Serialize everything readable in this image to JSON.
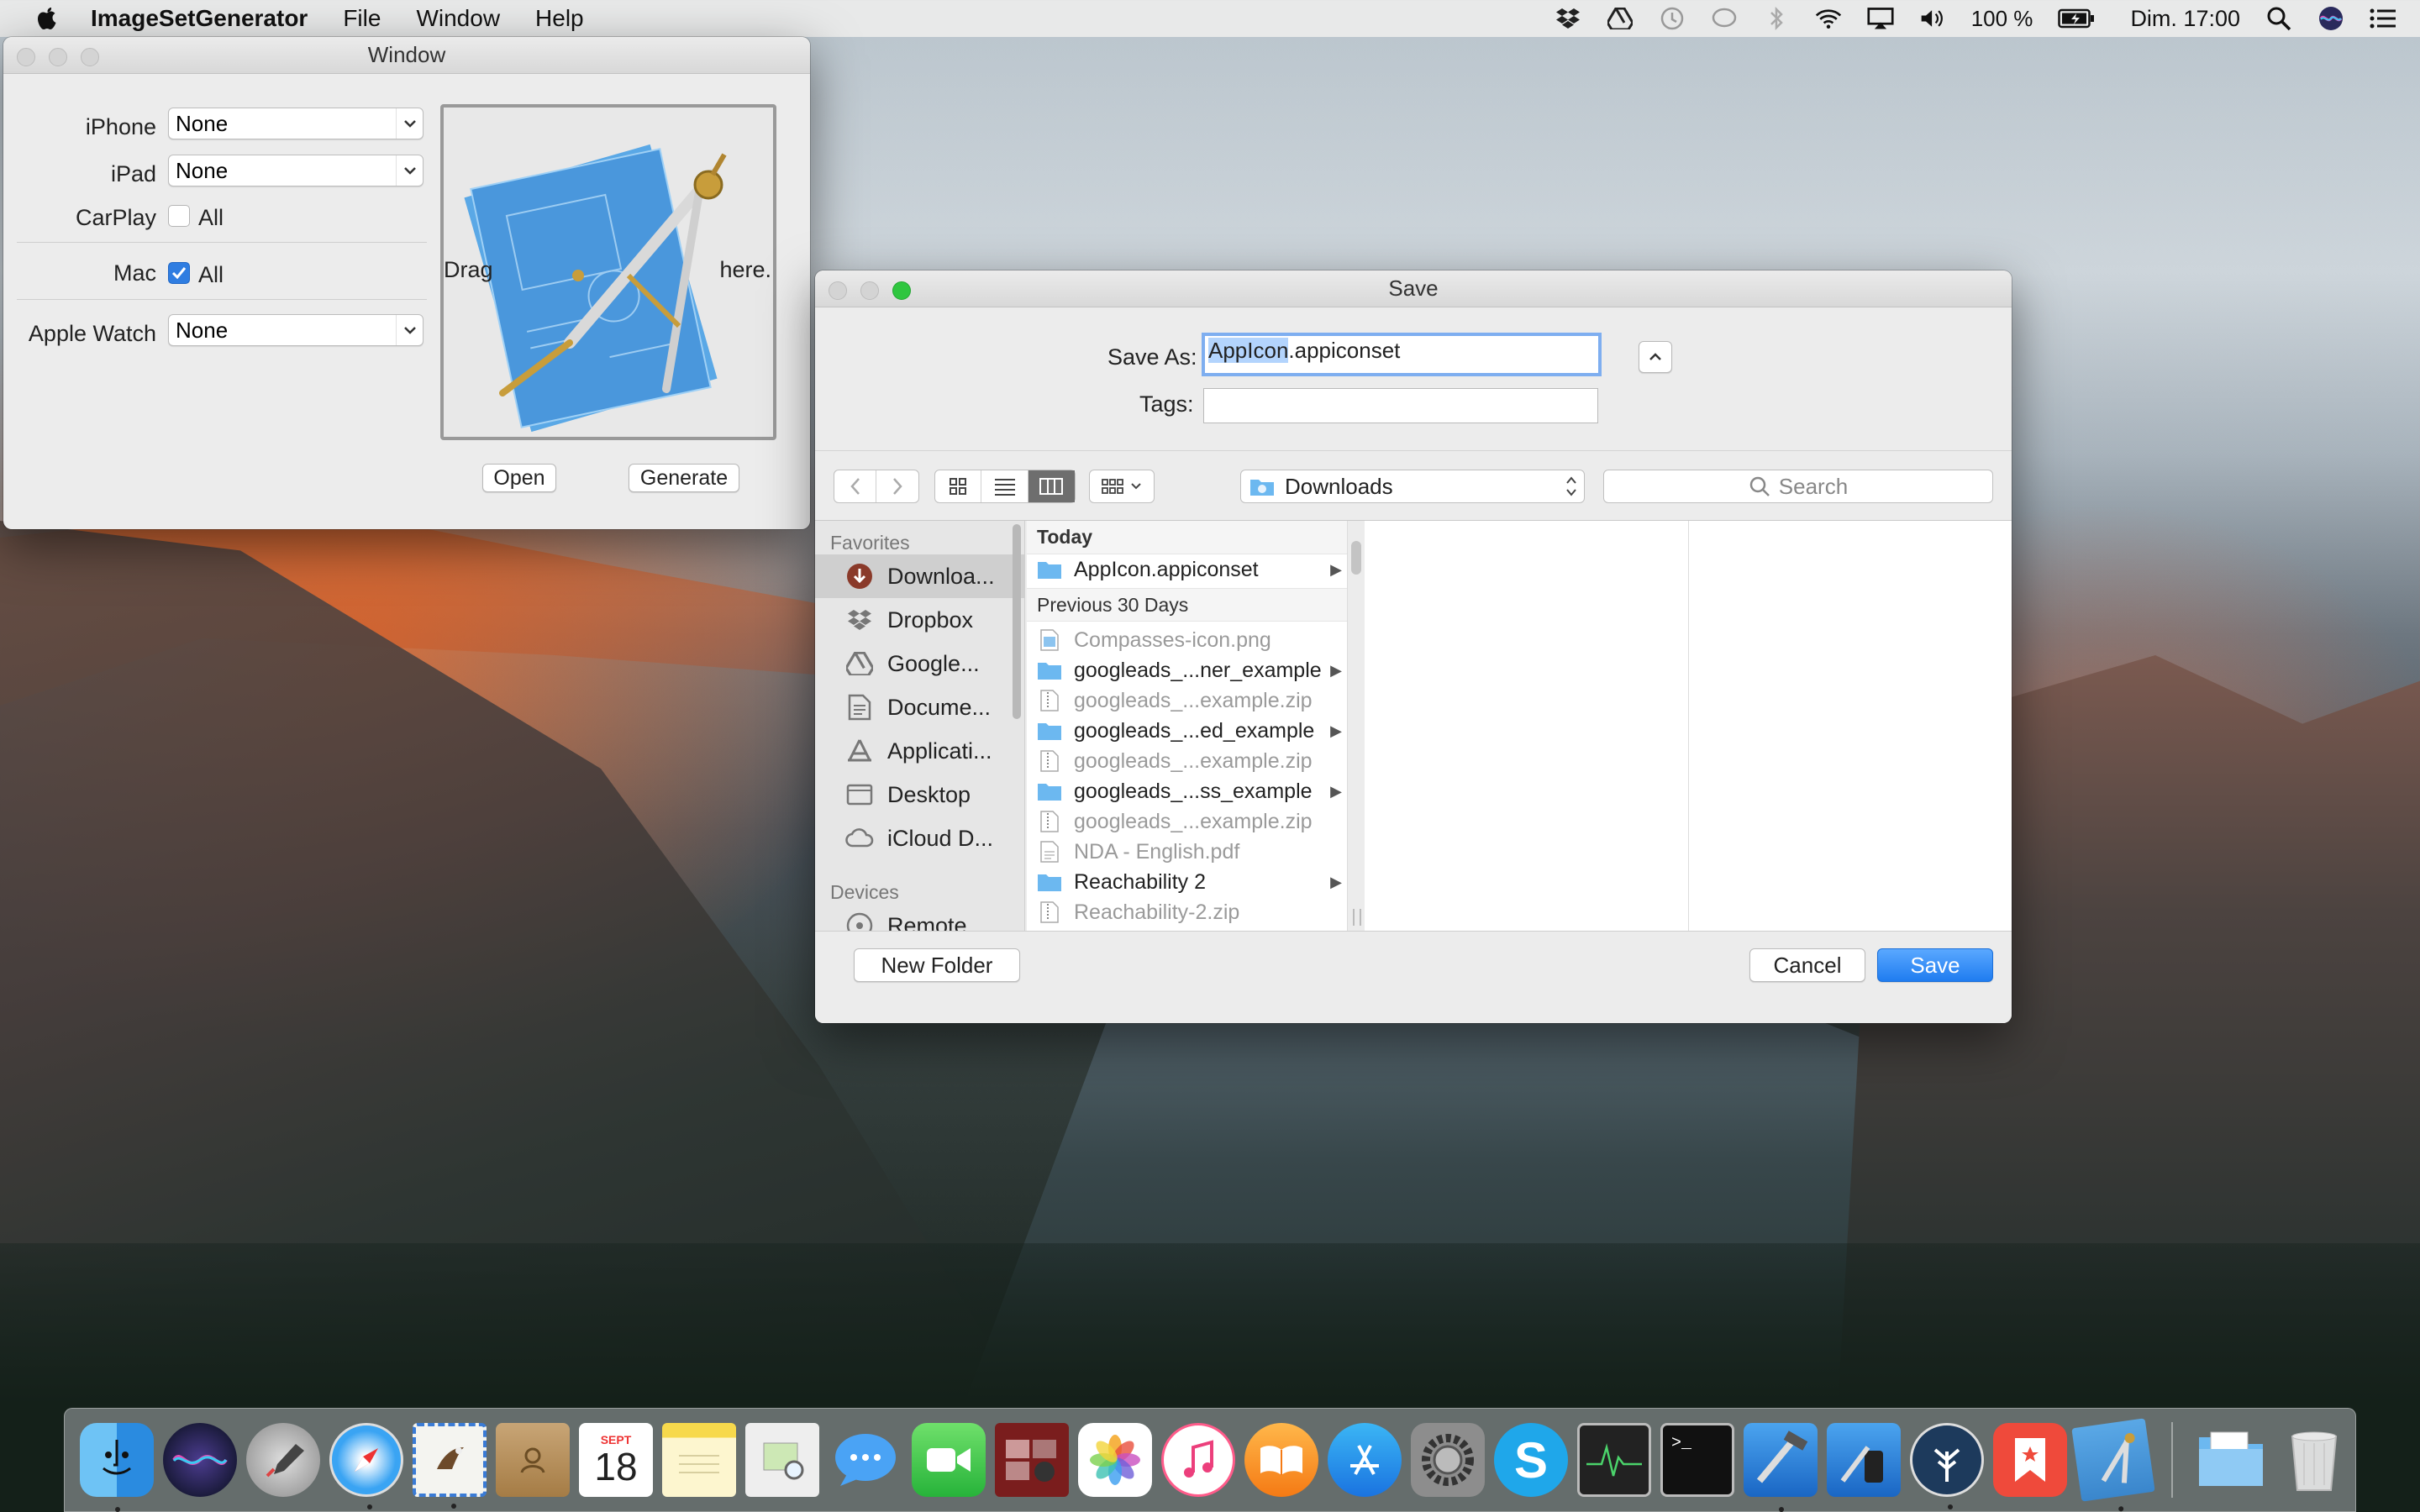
{
  "menubar": {
    "app_name": "ImageSetGenerator",
    "menus": [
      "File",
      "Window",
      "Help"
    ],
    "battery": "100 %",
    "clock": "Dim. 17:00"
  },
  "app_window": {
    "title": "Window",
    "iphone_label": "iPhone",
    "iphone_value": "None",
    "ipad_label": "iPad",
    "ipad_value": "None",
    "carplay_label": "CarPlay",
    "carplay_option": "All",
    "mac_label": "Mac",
    "mac_option": "All",
    "watch_label": "Apple Watch",
    "watch_value": "None",
    "drag_left": "Drag",
    "drag_right": "here.",
    "open_button": "Open",
    "generate_button": "Generate"
  },
  "save_dialog": {
    "title": "Save",
    "save_as_label": "Save As:",
    "save_as_selected": "AppIcon",
    "save_as_rest": ".appiconset",
    "tags_label": "Tags:",
    "location": "Downloads",
    "search_placeholder": "Search",
    "sidebar": {
      "favorites_header": "Favorites",
      "favorites": [
        "Downloa...",
        "Dropbox",
        "Google...",
        "Docume...",
        "Applicati...",
        "Desktop",
        "iCloud D..."
      ],
      "devices_header": "Devices",
      "devices": [
        "Remote..."
      ]
    },
    "today_header": "Today",
    "today_files": [
      {
        "name": "AppIcon.appiconset",
        "kind": "folder"
      }
    ],
    "previous_header": "Previous 30 Days",
    "previous_files": [
      {
        "name": "Compasses-icon.png",
        "kind": "image"
      },
      {
        "name": "googleads_...ner_example",
        "kind": "folder"
      },
      {
        "name": "googleads_...example.zip",
        "kind": "zip"
      },
      {
        "name": "googleads_...ed_example",
        "kind": "folder"
      },
      {
        "name": "googleads_...example.zip",
        "kind": "zip"
      },
      {
        "name": "googleads_...ss_example",
        "kind": "folder"
      },
      {
        "name": "googleads_...example.zip",
        "kind": "zip"
      },
      {
        "name": "NDA - English.pdf",
        "kind": "pdf"
      },
      {
        "name": "Reachability 2",
        "kind": "folder"
      },
      {
        "name": "Reachability-2.zip",
        "kind": "zip"
      }
    ],
    "new_folder_button": "New Folder",
    "cancel_button": "Cancel",
    "save_button": "Save"
  },
  "dock": {
    "calendar_month": "SEPT",
    "calendar_day": "18",
    "apps": [
      "finder-icon",
      "siri-icon",
      "launchpad-icon",
      "safari-icon",
      "mail-icon",
      "contacts-icon",
      "calendar-icon",
      "notes-icon",
      "preview-icon",
      "messages-icon",
      "facetime-icon",
      "photo-booth-icon",
      "photos-icon",
      "itunes-icon",
      "ibooks-icon",
      "app-store-icon",
      "system-preferences-icon",
      "skype-icon",
      "activity-monitor-icon",
      "terminal-icon",
      "xcode-icon",
      "simulator-icon",
      "sourcetree-icon",
      "bookmark-icon",
      "compasses-icon",
      "downloads-stack-icon",
      "trash-icon"
    ]
  }
}
